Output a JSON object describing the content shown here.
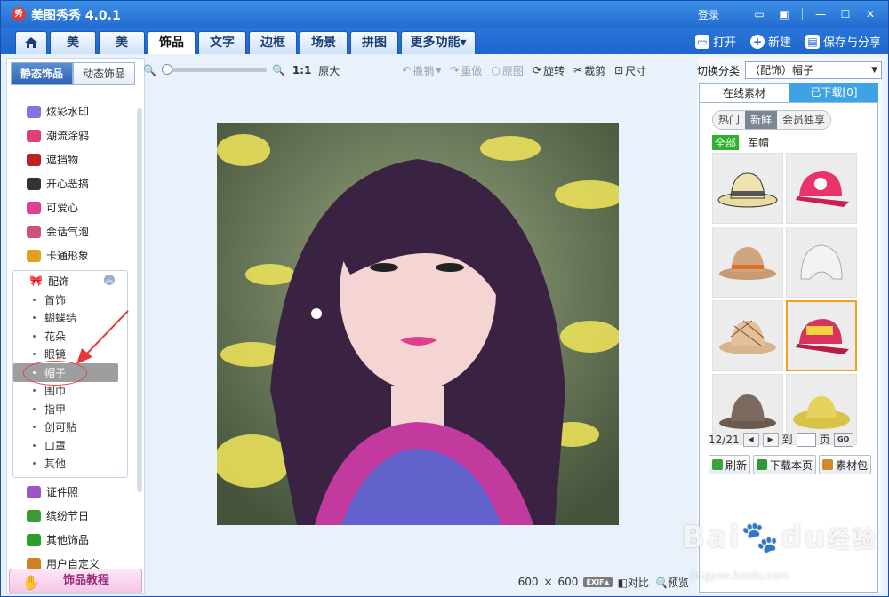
{
  "app": {
    "logo_text": "秀",
    "title": "美图秀秀 4.0.1",
    "login": "登录"
  },
  "nav": {
    "tabs": [
      "美化",
      "美容",
      "饰品",
      "文字",
      "边框",
      "场景",
      "拼图",
      "更多功能"
    ],
    "more_arrow": "▾",
    "open": "打开",
    "new": "新建",
    "save": "保存与分享"
  },
  "left": {
    "subtabs": [
      "静态饰品",
      "动态饰品"
    ],
    "categories": [
      {
        "label": "炫彩水印",
        "icon": "sparkle-icon",
        "color": "#8a6de0"
      },
      {
        "label": "潮流涂鸦",
        "icon": "lips-icon",
        "color": "#e0407a"
      },
      {
        "label": "遮挡物",
        "icon": "mask-icon",
        "color": "#c02020"
      },
      {
        "label": "开心恶搞",
        "icon": "funny-icon",
        "color": "#333333"
      },
      {
        "label": "可爱心",
        "icon": "heart-icon",
        "color": "#e04090"
      },
      {
        "label": "会话气泡",
        "icon": "bubble-icon",
        "color": "#d05080"
      },
      {
        "label": "卡通形象",
        "icon": "cartoon-icon",
        "color": "#e0a020"
      }
    ],
    "group_title": "配饰",
    "group_items": [
      "首饰",
      "蝴蝶结",
      "花朵",
      "眼镜",
      "帽子",
      "围巾",
      "指甲",
      "创可贴",
      "口罩",
      "其他"
    ],
    "categories2": [
      {
        "label": "证件照",
        "icon": "id-photo-icon",
        "color": "#9a55c9"
      },
      {
        "label": "缤纷节日",
        "icon": "gift-icon",
        "color": "#3a9a3a"
      },
      {
        "label": "其他饰品",
        "icon": "star-icon",
        "color": "#2aa02a"
      },
      {
        "label": "用户自定义",
        "icon": "custom-icon",
        "color": "#d08020"
      }
    ],
    "tutorial": "饰品教程"
  },
  "toolbar": {
    "ratio": "1:1",
    "original_size": "原大",
    "undo": "撤销",
    "redo": "重做",
    "reset": "原图",
    "rotate": "旋转",
    "crop": "裁剪",
    "resize": "尺寸"
  },
  "bottom": {
    "width": "600",
    "times": "×",
    "height": "600",
    "exif": "EXIF▲",
    "compare": "对比",
    "preview": "预览"
  },
  "right": {
    "switch_label": "切换分类",
    "switch_value": "（配饰）帽子",
    "tabs": [
      "在线素材",
      "已下载[0]"
    ],
    "pills": [
      "热门",
      "新鲜",
      "会员独享"
    ],
    "filters": [
      "全部",
      "军帽"
    ],
    "page": "12/21",
    "goto_prefix": "到",
    "goto_suffix": "页",
    "go": "GO",
    "refresh": "刷新",
    "download_page": "下载本页",
    "pack": "素材包"
  },
  "watermark": {
    "brand": "Bai",
    "brand2": "du",
    "brand3": "经验",
    "url": "jingyan.baidu.com"
  }
}
